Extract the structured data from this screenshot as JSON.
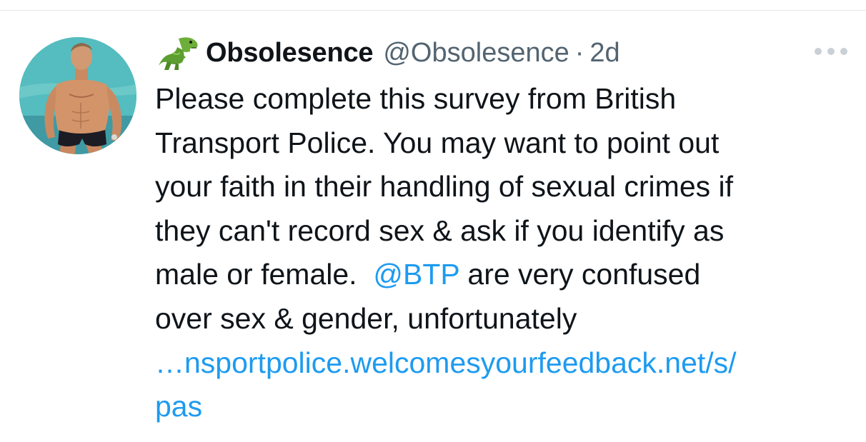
{
  "tweet": {
    "author": {
      "display_name": "Obsolesence",
      "handle": "@Obsolesence",
      "name_emoji": "t-rex-emoji"
    },
    "separator": "·",
    "timestamp": "2d",
    "more_icon": "more-horizontal-icon",
    "body": {
      "line1": "Please complete this survey from British",
      "line2": "Transport Police. You may want to point out",
      "line3": "your faith in their handling of sexual crimes if",
      "line4": "they can't record sex & ask if you identify as",
      "line5_before": "male or female.",
      "mention": "@BTP",
      "line5_after": "are very confused",
      "line6": "over sex & gender, unfortunately",
      "url_line1": "…nsportpolice.welcomesyourfeedback.net/s/",
      "url_line2": "pas"
    },
    "colors": {
      "text": "#0f1419",
      "secondary": "#536471",
      "link": "#1d9bf0"
    }
  }
}
